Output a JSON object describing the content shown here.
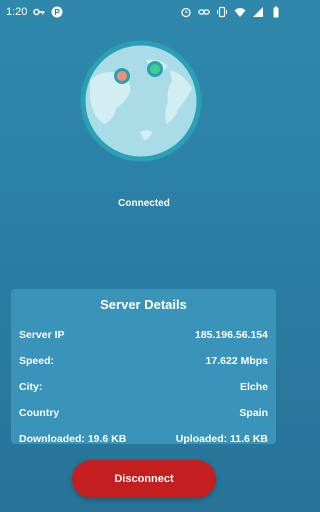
{
  "status_bar": {
    "time": "1:20"
  },
  "connection": {
    "status": "Connected"
  },
  "server_details": {
    "title": "Server Details",
    "rows": [
      {
        "label": "Server IP",
        "value": "185.196.56.154"
      },
      {
        "label": "Speed:",
        "value": "17.622 Mbps"
      },
      {
        "label": "City:",
        "value": "Elche"
      },
      {
        "label": "Country",
        "value": "Spain"
      },
      {
        "label": "Downloaded: 19.6 KB",
        "value": "Uploaded: 11.6 KB"
      }
    ]
  },
  "actions": {
    "disconnect_label": "Disconnect"
  },
  "colors": {
    "background": "#2b7fa4",
    "card": "#3a93b8",
    "disconnect": "#c41f1f",
    "globe": "#a9dce6",
    "globe_ring": "#2aa0b4"
  },
  "icons": [
    "key-icon",
    "p-app-icon",
    "alarm-icon",
    "link-icon",
    "vibrate-icon",
    "wifi-icon",
    "signal-icon",
    "battery-icon"
  ]
}
